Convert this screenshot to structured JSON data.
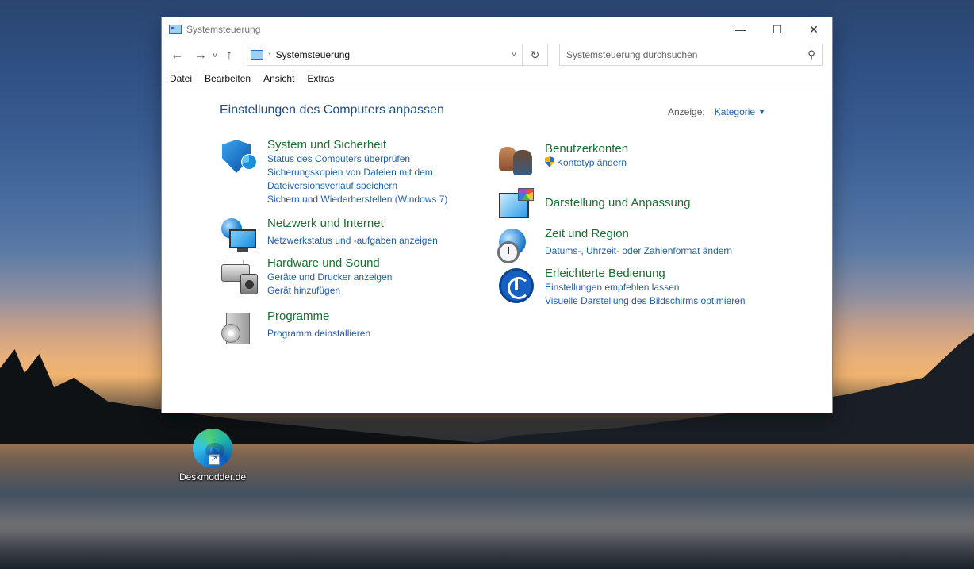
{
  "window": {
    "title": "Systemsteuerung",
    "controls": {
      "minimize": "—",
      "maximize": "☐",
      "close": "✕"
    }
  },
  "nav": {
    "back": "←",
    "forward": "→",
    "recent": "˅",
    "up": "↑",
    "address_separator": "›",
    "address": "Systemsteuerung",
    "dropdown": "˅",
    "refresh": "↻",
    "search_placeholder": "Systemsteuerung durchsuchen",
    "search_icon": "⚲"
  },
  "menu": [
    "Datei",
    "Bearbeiten",
    "Ansicht",
    "Extras"
  ],
  "content": {
    "heading": "Einstellungen des Computers anpassen",
    "view_label": "Anzeige:",
    "view_value": "Kategorie",
    "view_caret": "▼",
    "categories_left": [
      {
        "title": "System und Sicherheit",
        "icon": "shield-icon",
        "links": [
          "Status des Computers überprüfen",
          "Sicherungskopien von Dateien mit dem",
          "Dateiversionsverlauf speichern",
          "Sichern und Wiederherstellen (Windows 7)"
        ]
      },
      {
        "title": "Netzwerk und Internet",
        "icon": "network-icon",
        "links": [
          "Netzwerkstatus und -aufgaben anzeigen"
        ]
      },
      {
        "title": "Hardware und Sound",
        "icon": "hardware-sound-icon",
        "links": [
          "Geräte und Drucker anzeigen",
          "Gerät hinzufügen"
        ]
      },
      {
        "title": "Programme",
        "icon": "programs-icon",
        "links": [
          "Programm deinstallieren"
        ]
      }
    ],
    "categories_right": [
      {
        "title": "Benutzerkonten",
        "icon": "user-accounts-icon",
        "links": [
          "Kontotyp ändern"
        ]
      },
      {
        "title": "Darstellung und Anpassung",
        "icon": "appearance-icon",
        "links": []
      },
      {
        "title": "Zeit und Region",
        "icon": "clock-region-icon",
        "links": [
          "Datums-, Uhrzeit- oder Zahlenformat ändern"
        ]
      },
      {
        "title": "Erleichterte Bedienung",
        "icon": "ease-of-access-icon",
        "links": [
          "Einstellungen empfehlen lassen",
          "Visuelle Darstellung des Bildschirms optimieren"
        ]
      }
    ]
  },
  "desktop": {
    "shortcut_label": "Deskmodder.de",
    "shortcut_arrow": "↗"
  }
}
